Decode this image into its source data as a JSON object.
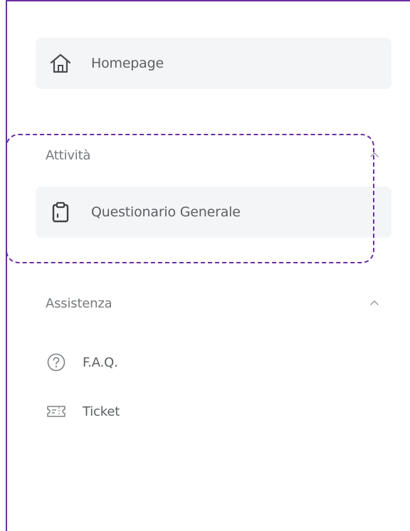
{
  "colors": {
    "frame": "#6b2fa0",
    "item_highlight": "#f4f5f7",
    "text": "#5c5f63",
    "section_text": "#767a7e"
  },
  "nav": {
    "home": {
      "label": "Homepage",
      "icon": "home-icon"
    }
  },
  "sections": [
    {
      "title": "Attività",
      "chevron": "chevron-up-icon",
      "items": [
        {
          "label": "Questionario Generale",
          "icon": "clipboard-icon"
        }
      ]
    },
    {
      "title": "Assistenza",
      "chevron": "chevron-up-icon",
      "items": [
        {
          "label": "F.A.Q.",
          "icon": "question-circle-icon"
        },
        {
          "label": "Ticket",
          "icon": "ticket-icon"
        }
      ]
    }
  ]
}
